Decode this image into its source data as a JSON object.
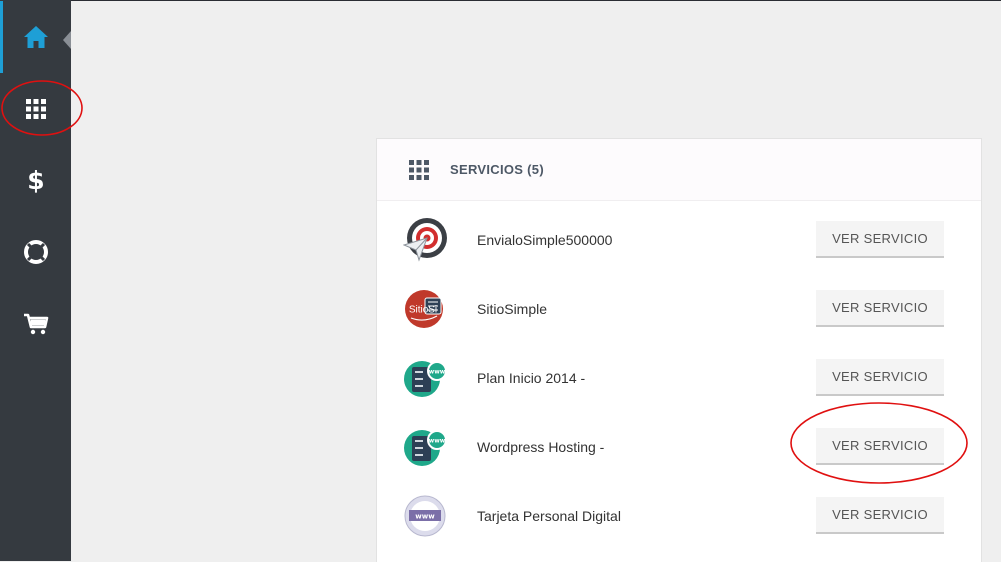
{
  "sidebar": {
    "items": [
      {
        "icon": "home-icon",
        "name": "sidebar-item-home"
      },
      {
        "icon": "grid-icon",
        "name": "sidebar-item-services"
      },
      {
        "icon": "dollar-icon",
        "name": "sidebar-item-billing"
      },
      {
        "icon": "lifebuoy-icon",
        "name": "sidebar-item-support"
      },
      {
        "icon": "cart-icon",
        "name": "sidebar-item-cart"
      }
    ],
    "accent_color": "#1e9fd6",
    "background_color": "#353a40"
  },
  "services_panel": {
    "title": "SERVICIOS (5)",
    "button_label": "VER SERVICIO",
    "rows": [
      {
        "name": "EnvialoSimple500000",
        "logo": "target-paperplane-icon"
      },
      {
        "name": "SitioSimple",
        "logo": "sitiosimple-logo-icon",
        "logo_text": "SitioSi"
      },
      {
        "name": "Plan Inicio 2014 -",
        "logo": "server-www-icon",
        "logo_text": "www"
      },
      {
        "name": "Wordpress Hosting -",
        "logo": "server-www-icon",
        "logo_text": "www"
      },
      {
        "name": "Tarjeta Personal Digital",
        "logo": "www-card-icon",
        "logo_text": "www"
      }
    ]
  },
  "annotation_color": "#e01010"
}
